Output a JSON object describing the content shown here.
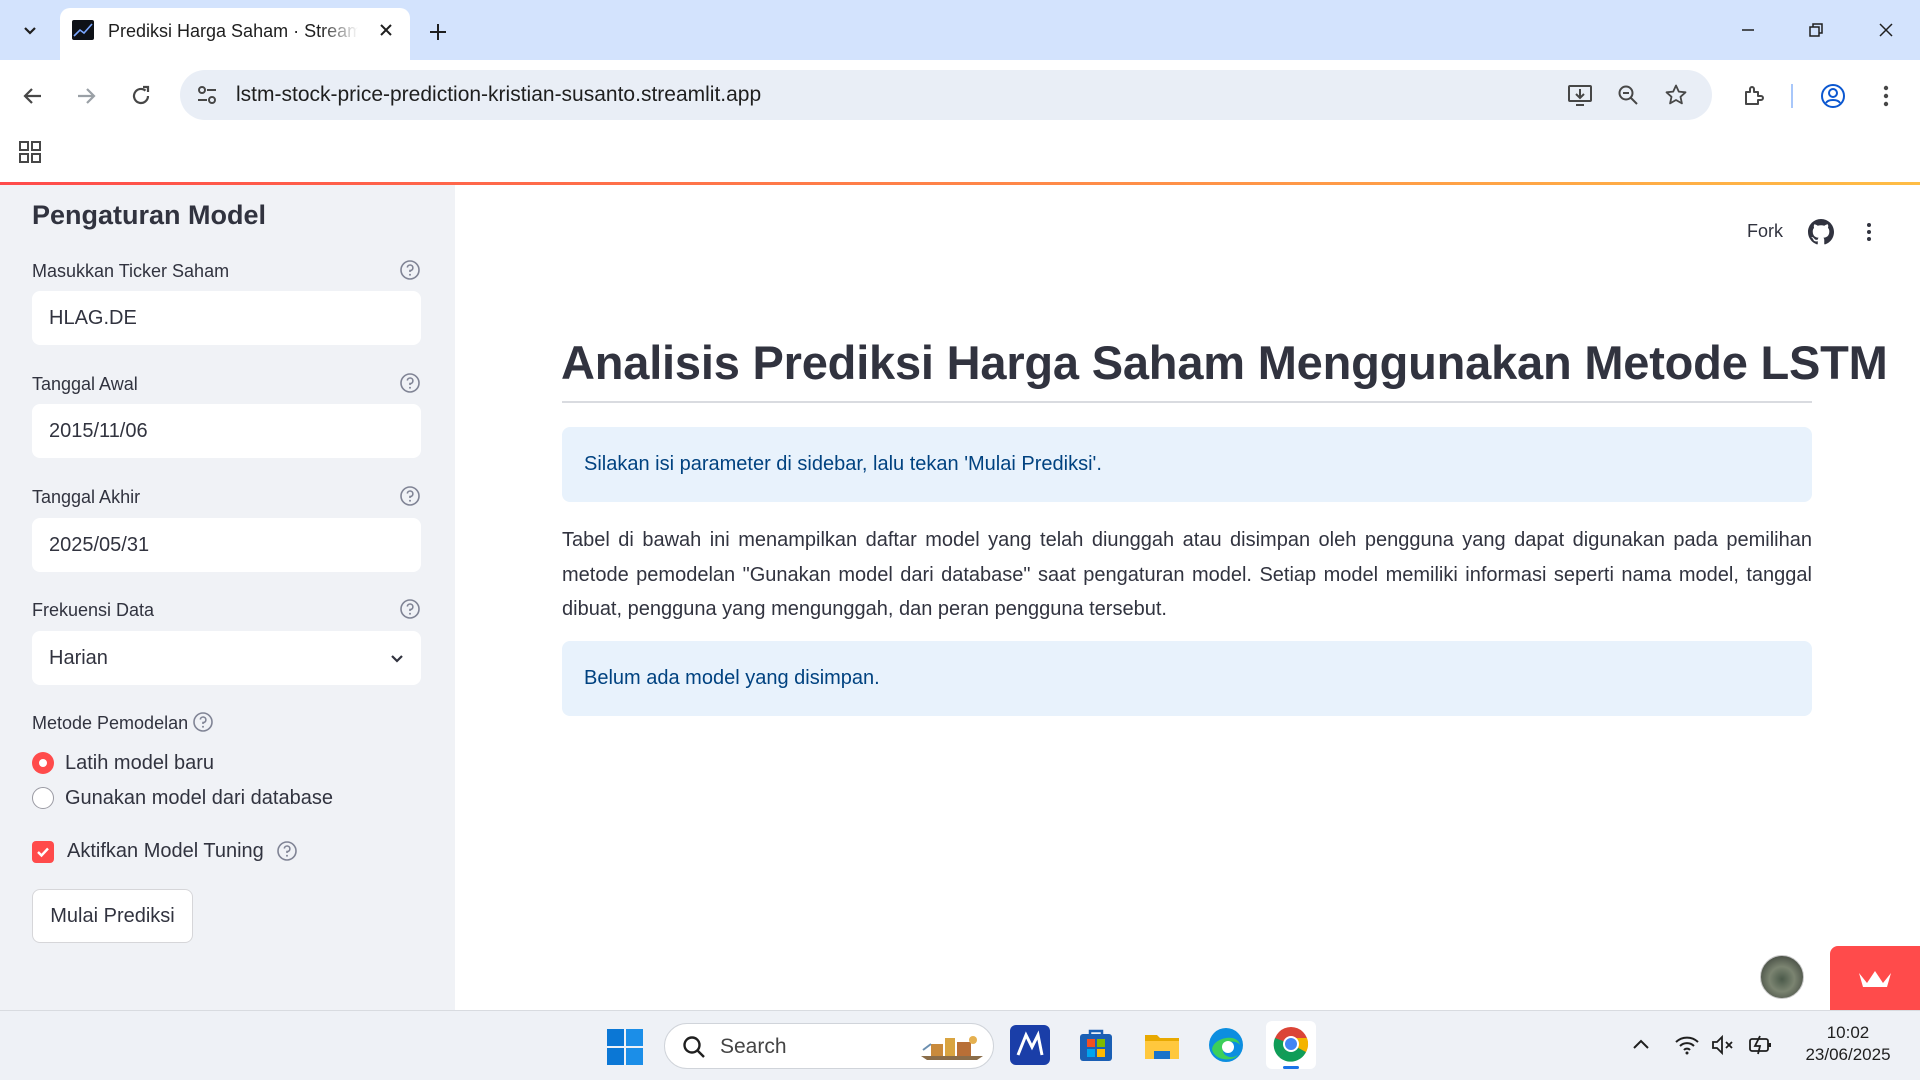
{
  "browser": {
    "tab_title": "Prediksi Harga Saham · Streamlit",
    "url": "lstm-stock-price-prediction-kristian-susanto.streamlit.app"
  },
  "sidebar": {
    "title": "Pengaturan Model",
    "ticker": {
      "label": "Masukkan Ticker Saham",
      "value": "HLAG.DE"
    },
    "start_date": {
      "label": "Tanggal Awal",
      "value": "2015/11/06"
    },
    "end_date": {
      "label": "Tanggal Akhir",
      "value": "2025/05/31"
    },
    "frequency": {
      "label": "Frekuensi Data",
      "value": "Harian"
    },
    "method": {
      "label": "Metode Pemodelan",
      "options": [
        "Latih model baru",
        "Gunakan model dari database"
      ],
      "selected": "Latih model baru"
    },
    "tuning": {
      "label": "Aktifkan Model Tuning",
      "checked": true
    },
    "submit_label": "Mulai Prediksi"
  },
  "header": {
    "fork_label": "Fork"
  },
  "main": {
    "title": "Analisis Prediksi Harga Saham Menggunakan Metode LSTM",
    "info_message": "Silakan isi parameter di sidebar, lalu tekan 'Mulai Prediksi'.",
    "description": "Tabel di bawah ini menampilkan daftar model yang telah diunggah atau disimpan oleh pengguna yang dapat digunakan pada pemilihan metode pemodelan \"Gunakan model dari database\" saat pengaturan model. Setiap model memiliki informasi seperti nama model, tanggal dibuat, pengguna yang mengunggah, dan peran pengguna tersebut.",
    "empty_message": "Belum ada model yang disimpan."
  },
  "taskbar": {
    "search_label": "Search",
    "time": "10:02",
    "date": "23/06/2025"
  },
  "colors": {
    "primary": "#ff4b4b",
    "sidebar_bg": "#f0f2f6",
    "info_bg": "#e8f2fc",
    "info_text": "#004280",
    "text": "#31333f"
  }
}
